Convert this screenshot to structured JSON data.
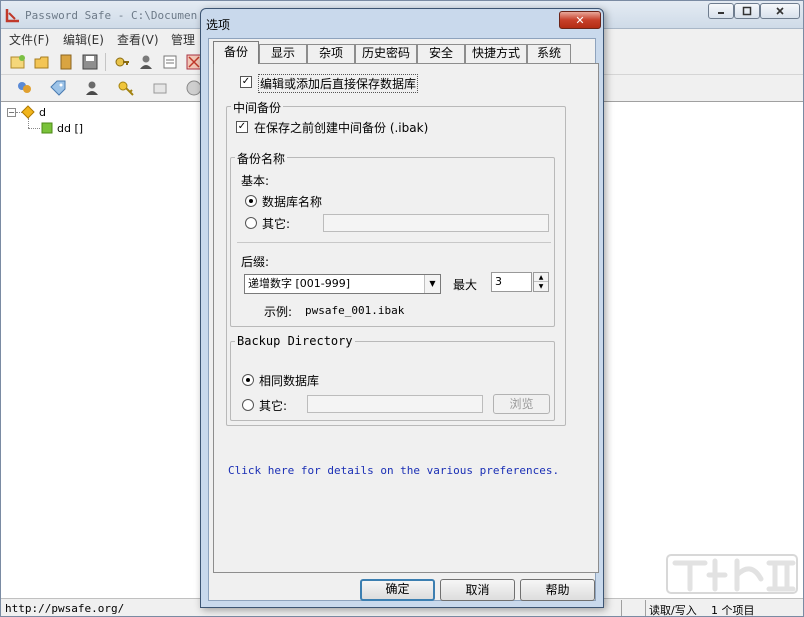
{
  "main_window": {
    "title": "Password Safe - C:\\Documen",
    "menu": [
      "文件(F)",
      "编辑(E)",
      "查看(V)",
      "管理"
    ],
    "tree": {
      "root_label": "d",
      "collapse_glyph": "−",
      "child_label": "dd []"
    },
    "status": {
      "url": "http://pwsafe.org/",
      "read_write": "读取/写入",
      "item_count": "1 个项目"
    }
  },
  "dialog": {
    "title": "选项",
    "close_glyph": "✕",
    "tabs": [
      "备份",
      "显示",
      "杂项",
      "历史密码",
      "安全",
      "快捷方式",
      "系统"
    ],
    "active_tab": "备份",
    "save_immediately": {
      "label": "编辑或添加后直接保存数据库",
      "checked": true
    },
    "intermediate_group": {
      "title": "中间备份",
      "create_label": "在保存之前创建中间备份 (.ibak)",
      "checked": true
    },
    "backup_name_group": {
      "title": "备份名称",
      "base_label": "基本:",
      "db_name_label": "数据库名称",
      "other_label": "其它:",
      "suffix_label": "后缀:",
      "suffix_value": "递增数字 [001-999]",
      "max_label": "最大",
      "max_value": "3",
      "example_label": "示例:",
      "example_value": "pwsafe_001.ibak"
    },
    "backup_dir_group": {
      "title": "Backup Directory",
      "same_db_label": "相同数据库",
      "other_label": "其它:",
      "browse_label": "浏览"
    },
    "help_link": "Click here for details on the various preferences.",
    "buttons": {
      "ok": "确定",
      "cancel": "取消",
      "help": "帮助"
    }
  }
}
